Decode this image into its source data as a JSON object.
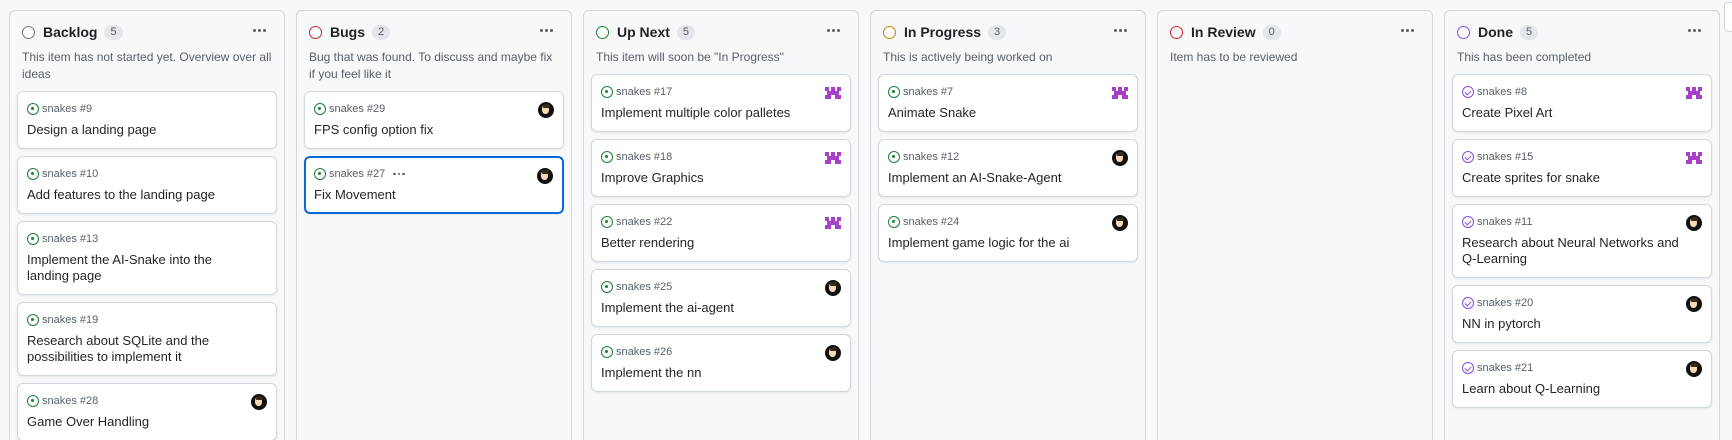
{
  "columns": [
    {
      "title": "Backlog",
      "count": "5",
      "status_color": "#6e7781",
      "description": "This item has not started yet. Overview over all ideas",
      "cards": [
        {
          "ref": "snakes #9",
          "title": "Design a landing page",
          "avatar": ""
        },
        {
          "ref": "snakes #10",
          "title": "Add features to the landing page",
          "avatar": ""
        },
        {
          "ref": "snakes #13",
          "title": "Implement the AI-Snake into the landing page",
          "avatar": ""
        },
        {
          "ref": "snakes #19",
          "title": "Research about SQLite and the possibilities to implement it",
          "avatar": ""
        },
        {
          "ref": "snakes #28",
          "title": "Game Over Handling",
          "avatar": "dark"
        }
      ]
    },
    {
      "title": "Bugs",
      "count": "2",
      "status_color": "#cf222e",
      "description": "Bug that was found. To discuss and maybe fix if you feel like it",
      "cards": [
        {
          "ref": "snakes #29",
          "title": "FPS config option fix",
          "avatar": "dark"
        },
        {
          "ref": "snakes #27",
          "title": "Fix Movement",
          "avatar": "dark",
          "selected": true
        }
      ]
    },
    {
      "title": "Up Next",
      "count": "5",
      "status_color": "#1a7f37",
      "description": "This item will soon be \"In Progress\"",
      "cards": [
        {
          "ref": "snakes #17",
          "title": "Implement multiple color palletes",
          "avatar": "pixel"
        },
        {
          "ref": "snakes #18",
          "title": "Improve Graphics",
          "avatar": "pixel"
        },
        {
          "ref": "snakes #22",
          "title": "Better rendering",
          "avatar": "pixel"
        },
        {
          "ref": "snakes #25",
          "title": "Implement the ai-agent",
          "avatar": "dark"
        },
        {
          "ref": "snakes #26",
          "title": "Implement the nn",
          "avatar": "dark"
        }
      ]
    },
    {
      "title": "In Progress",
      "count": "3",
      "status_color": "#bf8700",
      "description": "This is actively being worked on",
      "cards": [
        {
          "ref": "snakes #7",
          "title": "Animate Snake",
          "avatar": "pixel"
        },
        {
          "ref": "snakes #12",
          "title": "Implement an AI-Snake-Agent",
          "avatar": "dark"
        },
        {
          "ref": "snakes #24",
          "title": "Implement game logic for the ai",
          "avatar": "dark"
        }
      ]
    },
    {
      "title": "In Review",
      "count": "0",
      "status_color": "#cf222e",
      "description": "Item has to be reviewed",
      "cards": []
    },
    {
      "title": "Done",
      "count": "5",
      "status_color": "#8250df",
      "description": "This has been completed",
      "cards": [
        {
          "ref": "snakes #8",
          "title": "Create Pixel Art",
          "avatar": "pixel",
          "done": true
        },
        {
          "ref": "snakes #15",
          "title": "Create sprites for snake",
          "avatar": "pixel",
          "done": true
        },
        {
          "ref": "snakes #11",
          "title": "Research about Neural Networks and Q-Learning",
          "avatar": "dark",
          "done": true
        },
        {
          "ref": "snakes #20",
          "title": "NN in pytorch",
          "avatar": "dark",
          "done": true
        },
        {
          "ref": "snakes #21",
          "title": "Learn about Q-Learning",
          "avatar": "dark",
          "done": true
        }
      ]
    }
  ],
  "colors": {
    "accent": "#0969da",
    "open_issue": "#1a7f37",
    "closed_issue": "#8250df",
    "pixel_avatar": "#a940c9"
  }
}
